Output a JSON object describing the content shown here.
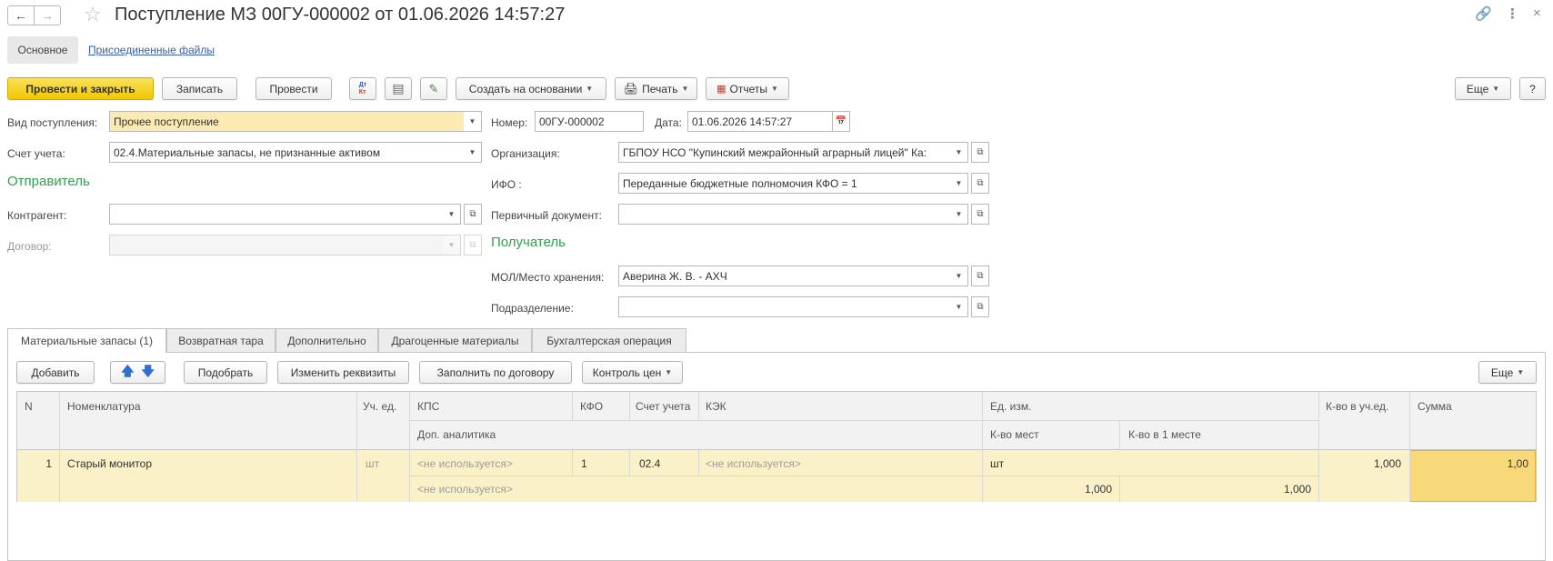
{
  "window": {
    "title": "Поступление МЗ 00ГУ-000002 от 01.06.2026 14:57:27"
  },
  "page_tabs": {
    "main": "Основное",
    "files": "Присоединенные файлы"
  },
  "toolbar": {
    "post_close": "Провести и закрыть",
    "save": "Записать",
    "post": "Провести",
    "create_based": "Создать на основании",
    "print": "Печать",
    "reports": "Отчеты",
    "more": "Еще",
    "help": "?",
    "dt_kt_top": "Дт",
    "dt_kt_bottom": "Кт"
  },
  "form": {
    "receipt_type_label": "Вид поступления:",
    "receipt_type_value": "Прочее поступление",
    "number_label": "Номер:",
    "number_value": "00ГУ-000002",
    "date_label": "Дата:",
    "date_value": "01.06.2026 14:57:27",
    "account_label": "Счет учета:",
    "account_value": "02.4.Материальные запасы, не признанные активом",
    "org_label": "Организация:",
    "org_value": "ГБПОУ НСО \"Купинский межрайонный аграрный лицей\" Ка:",
    "sender_title": "Отправитель",
    "ifo_label": "ИФО :",
    "ifo_value": "Переданные бюджетные полномочия КФО = 1",
    "counterparty_label": "Контрагент:",
    "counterparty_value": "",
    "primary_doc_label": "Первичный документ:",
    "primary_doc_value": "",
    "contract_label": "Договор:",
    "contract_value": "",
    "recipient_title": "Получатель",
    "mol_label": "МОЛ/Место хранения:",
    "mol_value": "Аверина Ж. В. - АХЧ",
    "division_label": "Подразделение:",
    "division_value": ""
  },
  "tabs": [
    {
      "label": "Материальные запасы (1)",
      "active": true
    },
    {
      "label": "Возвратная тара",
      "active": false
    },
    {
      "label": "Дополнительно",
      "active": false
    },
    {
      "label": "Драгоценные материалы",
      "active": false
    },
    {
      "label": "Бухгалтерская операция",
      "active": false
    }
  ],
  "table_toolbar": {
    "add": "Добавить",
    "pick": "Подобрать",
    "change_props": "Изменить реквизиты",
    "fill_contract": "Заполнить по договору",
    "price_control": "Контроль цен",
    "more": "Еще"
  },
  "table": {
    "headers": {
      "n": "N",
      "nomenclature": "Номенклатура",
      "unit": "Уч. ед.",
      "kps": "КПС",
      "kfo": "КФО",
      "account": "Счет учета",
      "kek": "КЭК",
      "ed_izm": "Ед. изм.",
      "qty_unit": "К-во в уч.ед.",
      "sum": "Сумма",
      "dop_analytics": "Доп. аналитика",
      "qty_places": "К-во мест",
      "qty_per_place": "К-во в 1 месте"
    },
    "rows": [
      {
        "n": "1",
        "nomenclature": "Старый монитор",
        "unit": "шт",
        "kps": "<не используется>",
        "kfo": "1",
        "account": "02.4",
        "kek": "<не используется>",
        "ed_izm": "шт",
        "qty_unit": "1,000",
        "sum": "1,00",
        "dop_analytics": "<не используется>",
        "qty_places": "1,000",
        "qty_per_place": "1,000"
      }
    ]
  }
}
